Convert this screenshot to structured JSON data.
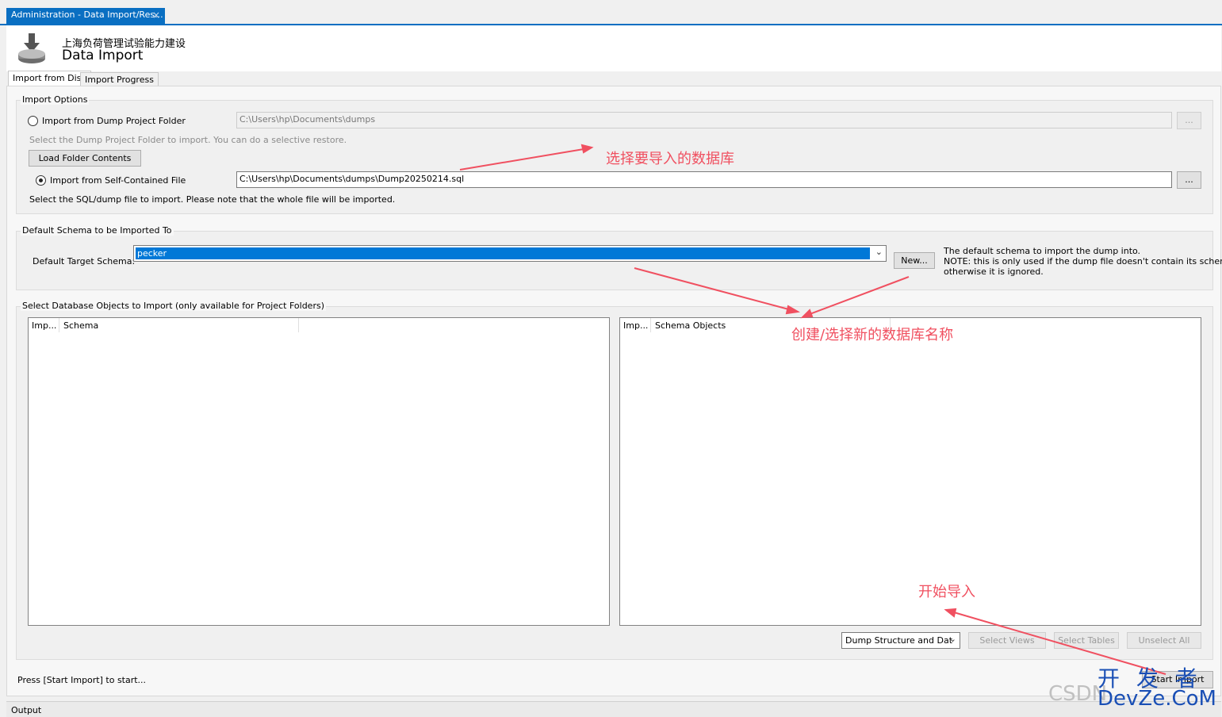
{
  "window": {
    "tab_title": "Administration - Data Import/Res...",
    "close_glyph": "×"
  },
  "header": {
    "subtitle": "上海负荷管理试验能力建设",
    "title": "Data Import",
    "icon": "database-import-icon"
  },
  "tabs": [
    {
      "label": "Import from Disk",
      "active": true
    },
    {
      "label": "Import Progress",
      "active": false
    }
  ],
  "import_options": {
    "group_label": "Import Options",
    "folder_option_label": "Import from Dump Project Folder",
    "folder_path": "C:\\Users\\hp\\Documents\\dumps",
    "folder_hint": "Select the Dump Project Folder to import. You can do a selective restore.",
    "load_button": "Load Folder Contents",
    "file_option_label": "Import from Self-Contained File",
    "file_path": "C:\\Users\\hp\\Documents\\dumps\\Dump20250214.sql",
    "file_hint": "Select the SQL/dump file to import. Please note that the whole file will be imported.",
    "browse_label": "...",
    "selected_option": "self-contained-file"
  },
  "default_schema": {
    "group_label": "Default Schema to be Imported To",
    "field_label": "Default Target Schema:",
    "selected_value": "pecker",
    "new_button": "New...",
    "note_line1": "The default schema to import the dump into.",
    "note_line2": "NOTE: this is only used if the dump file doesn't contain its schema,",
    "note_line3": "otherwise it is ignored."
  },
  "objects": {
    "group_label": "Select Database Objects to Import (only available for Project Folders)",
    "left_columns": [
      "Imp...",
      "Schema"
    ],
    "right_columns": [
      "Imp...",
      "Schema Objects"
    ],
    "dump_select": "Dump Structure and Dat",
    "select_views": "Select Views",
    "select_tables": "Select Tables",
    "unselect_all": "Unselect All"
  },
  "footer": {
    "status": "Press [Start Import] to start...",
    "start_button": "Start Import"
  },
  "output": {
    "label": "Output"
  },
  "annotations": {
    "select_db": "选择要导入的数据库",
    "create_db": "创建/选择新的数据库名称",
    "start_import": "开始导入",
    "annotation_color": "#f05060"
  },
  "watermark": {
    "line1": "开 发 者",
    "line2": "DevZe.CoM",
    "csdn": "CSDN"
  },
  "colors": {
    "accent": "#0a6fc2",
    "selection": "#0078d7"
  }
}
